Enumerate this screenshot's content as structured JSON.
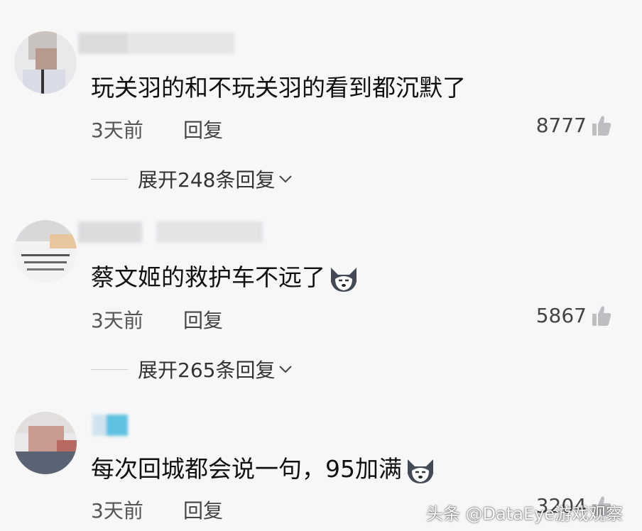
{
  "comments": [
    {
      "text": "玩关羽的和不玩关羽的看到都沉默了",
      "has_emoji": false,
      "time": "3天前",
      "reply_label": "回复",
      "likes": "8777",
      "expand_label": "展开248条回复"
    },
    {
      "text": "蔡文姬的救护车不远了",
      "has_emoji": true,
      "time": "3天前",
      "reply_label": "回复",
      "likes": "5867",
      "expand_label": "展开265条回复"
    },
    {
      "text": "每次回城都会说一句，95加满",
      "has_emoji": true,
      "time": "3天前",
      "reply_label": "回复",
      "likes": "3204"
    }
  ],
  "watermark": "头条 @DataEye游戏观察",
  "icons": {
    "like": "thumbs-up-icon",
    "expand": "chevron-down-icon",
    "emoji": "husky-dog-emoji"
  }
}
